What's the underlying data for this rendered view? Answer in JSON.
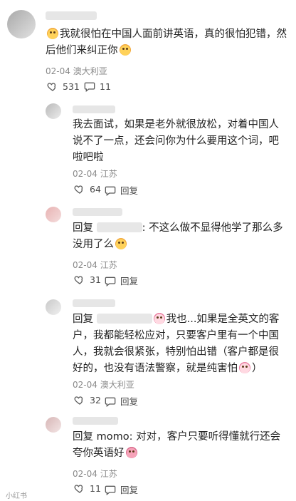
{
  "main_comment": {
    "text": "我就很怕在中国人面前讲英语，真的很怕犯错，然后他们来纠正你",
    "date": "02-04",
    "location": "澳大利亚",
    "likes": "531",
    "comments": "11"
  },
  "replies": [
    {
      "prefix": "",
      "mention": "",
      "text": "我去面试，如果是老外就很放松，对着中国人说不了一点，还会问你为什么要用这个词，吧啦吧啦",
      "date": "02-04",
      "location": "江苏",
      "likes": "64",
      "reply_label": "回复"
    },
    {
      "prefix": "回复",
      "mention": "",
      "text": ": 不这么做不显得他学了那么多没用了么",
      "date": "02-04",
      "location": "江苏",
      "likes": "31",
      "reply_label": "回复"
    },
    {
      "prefix": "回复",
      "mention": "",
      "text": "我也...如果是全英文的客户，我都能轻松应对，只要客户里有一个中国人，我就会很紧张，特别怕出错（客户都是很好的，也没有语法警察，就是纯害怕",
      "text_end": "）",
      "date": "02-04",
      "location": "澳大利亚",
      "likes": "32",
      "reply_label": "回复"
    },
    {
      "prefix": "回复",
      "mention": "momo",
      "text": ": 对对，客户只要听得懂就行还会夸你英语好",
      "date": "02-04",
      "location": "江苏",
      "likes": "11",
      "reply_label": "回复"
    }
  ],
  "icons": {
    "like": "thumbs-up-icon",
    "comment": "comment-bubble-icon",
    "emoji": "face-emoji-icon"
  },
  "watermark": "小红书"
}
